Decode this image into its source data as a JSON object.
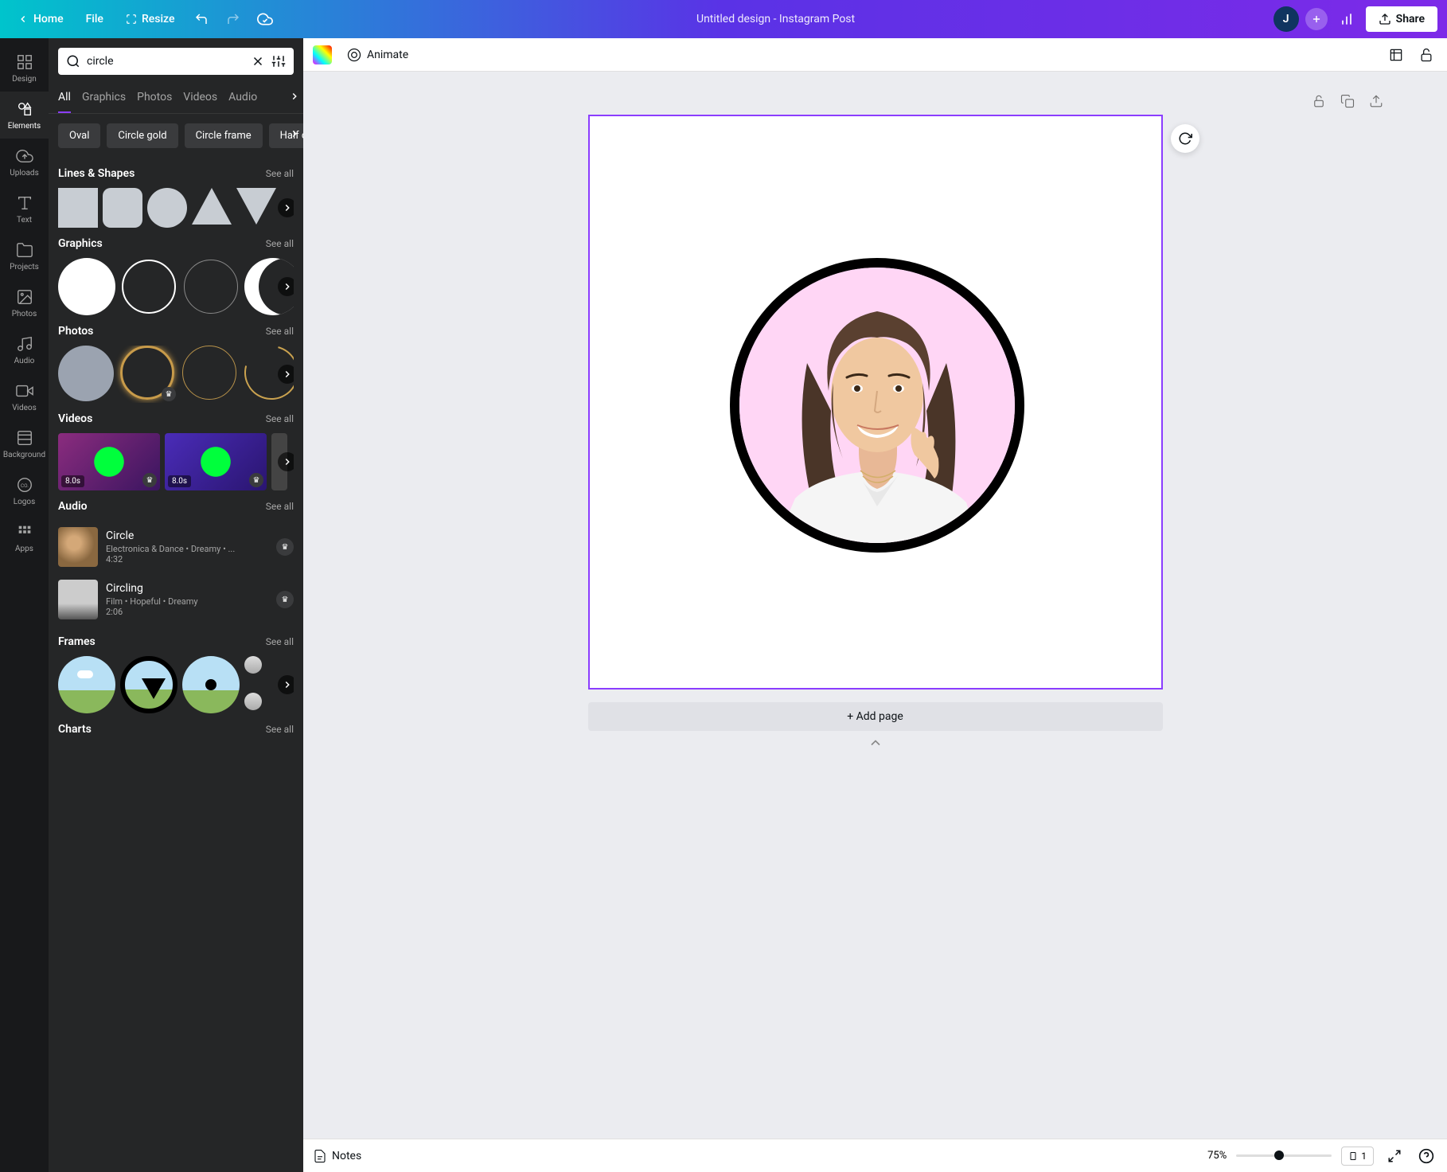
{
  "header": {
    "home": "Home",
    "file": "File",
    "resize": "Resize",
    "title": "Untitled design - Instagram Post",
    "avatar_initial": "J",
    "share": "Share"
  },
  "rail": {
    "items": [
      {
        "label": "Design"
      },
      {
        "label": "Elements"
      },
      {
        "label": "Uploads"
      },
      {
        "label": "Text"
      },
      {
        "label": "Projects"
      },
      {
        "label": "Photos"
      },
      {
        "label": "Audio"
      },
      {
        "label": "Videos"
      },
      {
        "label": "Background"
      },
      {
        "label": "Logos"
      },
      {
        "label": "Apps"
      }
    ]
  },
  "search": {
    "value": "circle"
  },
  "tabs": [
    "All",
    "Graphics",
    "Photos",
    "Videos",
    "Audio"
  ],
  "chips": [
    "Oval",
    "Circle gold",
    "Circle frame",
    "Half c"
  ],
  "sections": {
    "lines_shapes": {
      "title": "Lines & Shapes",
      "see_all": "See all"
    },
    "graphics": {
      "title": "Graphics",
      "see_all": "See all"
    },
    "photos": {
      "title": "Photos",
      "see_all": "See all"
    },
    "videos": {
      "title": "Videos",
      "see_all": "See all"
    },
    "audio": {
      "title": "Audio",
      "see_all": "See all"
    },
    "frames": {
      "title": "Frames",
      "see_all": "See all"
    },
    "charts": {
      "title": "Charts",
      "see_all": "See all"
    }
  },
  "videos": [
    {
      "duration": "8.0s"
    },
    {
      "duration": "8.0s"
    }
  ],
  "audio": [
    {
      "title": "Circle",
      "meta": "Electronica & Dance • Dreamy • ...",
      "duration": "4:32"
    },
    {
      "title": "Circling",
      "meta": "Film • Hopeful • Dreamy",
      "duration": "2:06"
    }
  ],
  "context": {
    "animate": "Animate"
  },
  "canvas": {
    "add_page": "+ Add page"
  },
  "bottom": {
    "notes": "Notes",
    "zoom": "75%",
    "pages": "1"
  }
}
